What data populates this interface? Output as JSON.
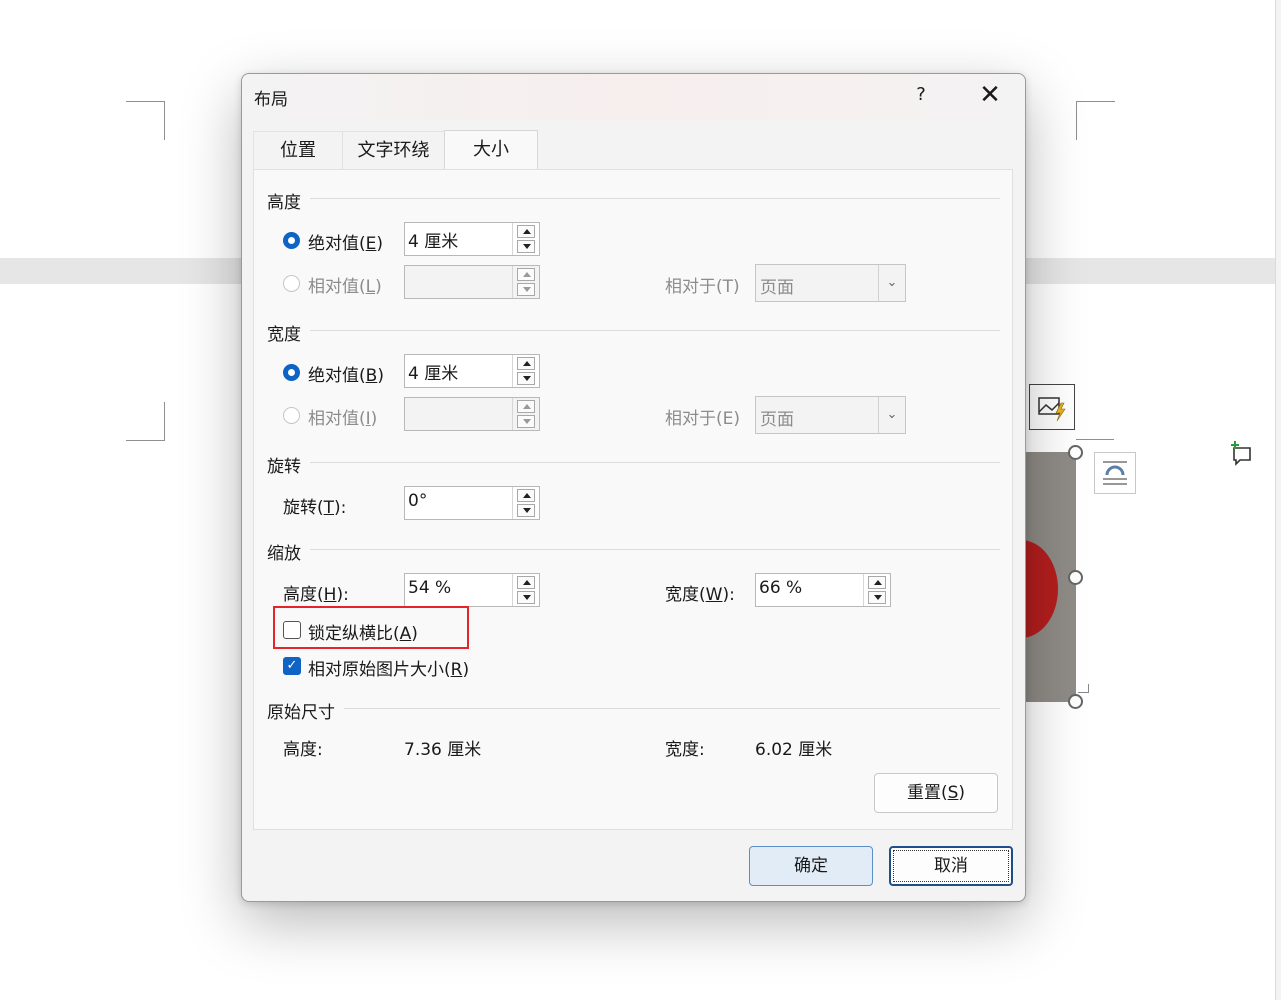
{
  "dialog": {
    "title": "布局",
    "help": "?",
    "close": "✕",
    "tabs": [
      {
        "label": "位置"
      },
      {
        "label": "文字环绕"
      },
      {
        "label": "大小"
      }
    ],
    "height_section": {
      "title": "高度",
      "absolute_pre": "绝对值(",
      "absolute_key": "E",
      "absolute_post": ")",
      "absolute_value": "4 厘米",
      "relative_pre": "相对值(",
      "relative_key": "L",
      "relative_post": ")",
      "relative_to_label": "相对于(T)",
      "relative_to_value": "页面"
    },
    "width_section": {
      "title": "宽度",
      "absolute_pre": "绝对值(",
      "absolute_key": "B",
      "absolute_post": ")",
      "absolute_value": "4 厘米",
      "relative_pre": "相对值(",
      "relative_key": "I",
      "relative_post": ")",
      "relative_to_label": "相对于(E)",
      "relative_to_value": "页面"
    },
    "rotation_section": {
      "title": "旋转",
      "label_pre": "旋转(",
      "label_key": "T",
      "label_post": "):",
      "value": "0°"
    },
    "scale_section": {
      "title": "缩放",
      "height_pre": "高度(",
      "height_key": "H",
      "height_post": "):",
      "height_value": "54 %",
      "width_pre": "宽度(",
      "width_key": "W",
      "width_post": "):",
      "width_value": "66 %",
      "lock_pre": "锁定纵横比(",
      "lock_key": "A",
      "lock_post": ")",
      "lock_checked": false,
      "relative_pre": "相对原始图片大小(",
      "relative_key": "R",
      "relative_post": ")",
      "relative_checked": true
    },
    "original_section": {
      "title": "原始尺寸",
      "height_label": "高度:",
      "height_value": "7.36 厘米",
      "width_label": "宽度:",
      "width_value": "6.02 厘米"
    },
    "reset_pre": "重置(",
    "reset_key": "S",
    "reset_post": ")",
    "ok_label": "确定",
    "cancel_label": "取消"
  },
  "colors": {
    "accent": "#0f63c4",
    "highlight_box": "#e3262b",
    "comment_icon": "#2e9a3a"
  },
  "icons": [
    "close-icon",
    "help-icon",
    "layout-options-icon",
    "image-insert-icon",
    "new-comment-icon",
    "paragraph-mark-icon"
  ]
}
